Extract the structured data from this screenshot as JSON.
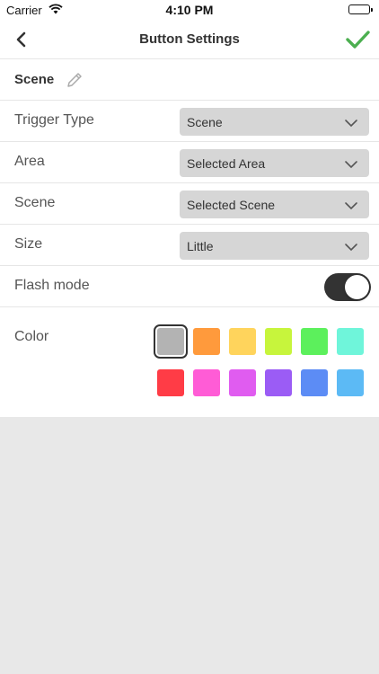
{
  "status_bar": {
    "carrier": "Carrier",
    "time": "4:10 PM"
  },
  "nav": {
    "title": "Button Settings",
    "back_icon": "chevron-left-icon",
    "confirm_icon": "checkmark-icon",
    "confirm_color": "#4caf50"
  },
  "name_row": {
    "name": "Scene",
    "edit_icon": "pencil-icon"
  },
  "settings": [
    {
      "label": "Trigger Type",
      "value": "Scene"
    },
    {
      "label": "Area",
      "value": "Selected Area"
    },
    {
      "label": "Scene",
      "value": "Selected Scene"
    },
    {
      "label": "Size",
      "value": "Little"
    }
  ],
  "flash_mode": {
    "label": "Flash mode",
    "enabled": true
  },
  "color": {
    "label": "Color",
    "selected_index": 0,
    "swatches": [
      "#b3b3b3",
      "#ff9a3c",
      "#ffd45c",
      "#c7f53c",
      "#5cf05c",
      "#6ff5da",
      "#ff3c46",
      "#ff5cd6",
      "#e05cf0",
      "#9b5cf5",
      "#5c8cf5",
      "#5cbaf5"
    ]
  }
}
